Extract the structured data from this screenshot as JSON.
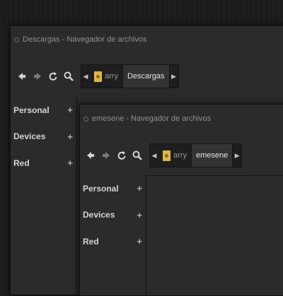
{
  "windows": [
    {
      "title": "Descargas - Navegador de archivos",
      "path": [
        "arry",
        "Descargas"
      ],
      "sidebar": [
        {
          "label": "Personal",
          "action": "+"
        },
        {
          "label": "Devices",
          "action": "+"
        },
        {
          "label": "Red",
          "action": "+"
        }
      ]
    },
    {
      "title": "emesene - Navegador de archivos",
      "path": [
        "arry",
        "emesene"
      ],
      "sidebar": [
        {
          "label": "Personal",
          "action": "+"
        },
        {
          "label": "Devices",
          "action": "+"
        },
        {
          "label": "Red",
          "action": "+"
        }
      ]
    }
  ],
  "icons": [
    "back-icon",
    "forward-icon",
    "reload-icon",
    "search-icon",
    "folder-icon",
    "plus-icon"
  ],
  "colors": {
    "background": "#1b1b1b",
    "window": "#2b2b2b",
    "folder": "#e0b84a",
    "text": "#d4d4d4"
  }
}
